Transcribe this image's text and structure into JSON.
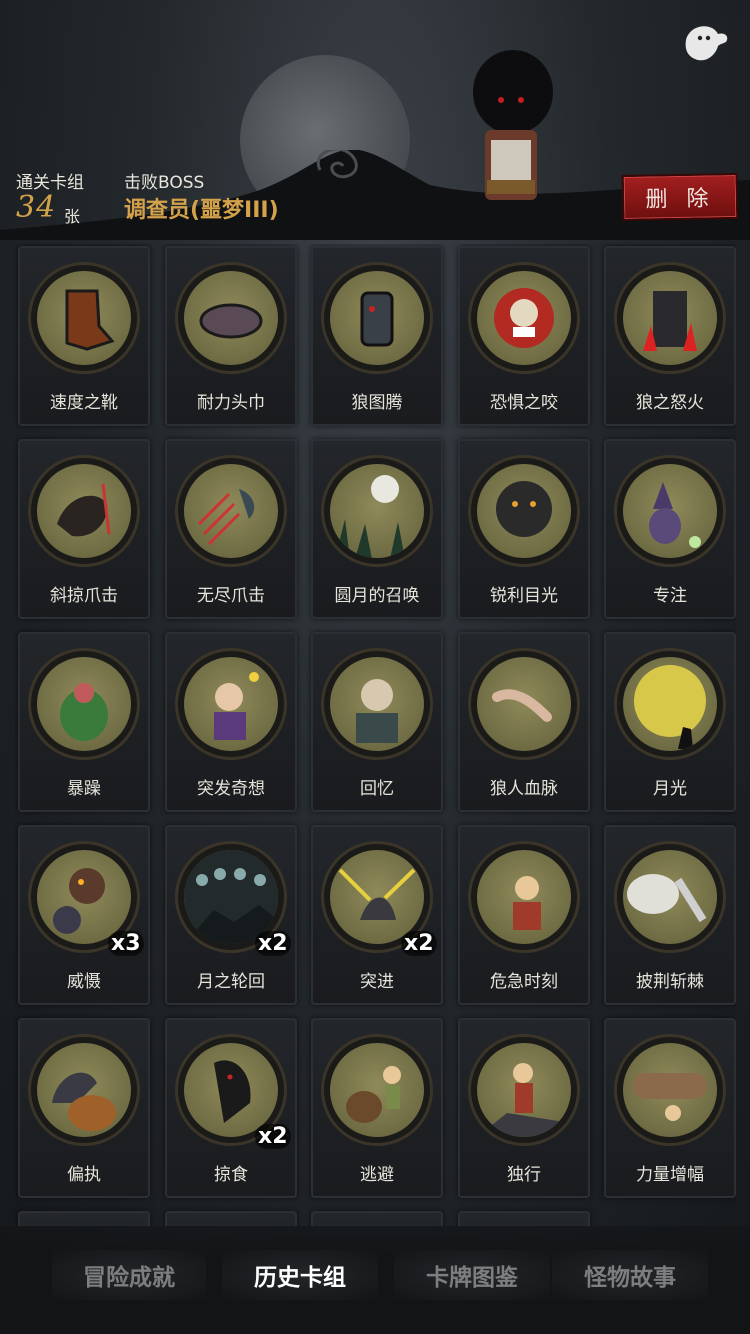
{
  "header": {
    "cleared_decks_label": "通关卡组",
    "cleared_decks_count": "34",
    "cleared_decks_unit": "张",
    "boss_label": "击败BOSS",
    "boss_name": "调查员(噩梦III)",
    "delete_label": "删 除",
    "ghost_icon": "ghost-icon"
  },
  "cards": [
    {
      "name": "速度之靴",
      "icon": "boot-icon"
    },
    {
      "name": "耐力头巾",
      "icon": "bandana-icon"
    },
    {
      "name": "狼图腾",
      "icon": "wolf-totem-icon"
    },
    {
      "name": "恐惧之咬",
      "icon": "fear-bite-icon"
    },
    {
      "name": "狼之怒火",
      "icon": "wolf-rage-icon"
    },
    {
      "name": "斜掠爪击",
      "icon": "slash-claw-icon"
    },
    {
      "name": "无尽爪击",
      "icon": "endless-claw-icon"
    },
    {
      "name": "圆月的召唤",
      "icon": "full-moon-call-icon"
    },
    {
      "name": "锐利目光",
      "icon": "sharp-gaze-icon"
    },
    {
      "name": "专注",
      "icon": "focus-icon"
    },
    {
      "name": "暴躁",
      "icon": "irritable-icon"
    },
    {
      "name": "突发奇想",
      "icon": "sudden-idea-icon"
    },
    {
      "name": "回忆",
      "icon": "memory-icon"
    },
    {
      "name": "狼人血脉",
      "icon": "werewolf-blood-icon"
    },
    {
      "name": "月光",
      "icon": "moonlight-icon"
    },
    {
      "name": "威慑",
      "icon": "intimidate-icon",
      "count": "x3"
    },
    {
      "name": "月之轮回",
      "icon": "moon-cycle-icon",
      "count": "x2"
    },
    {
      "name": "突进",
      "icon": "charge-icon",
      "count": "x2"
    },
    {
      "name": "危急时刻",
      "icon": "critical-moment-icon"
    },
    {
      "name": "披荆斩棘",
      "icon": "thorns-icon"
    },
    {
      "name": "偏执",
      "icon": "paranoia-icon"
    },
    {
      "name": "掠食",
      "icon": "predation-icon",
      "count": "x2"
    },
    {
      "name": "逃避",
      "icon": "escape-icon"
    },
    {
      "name": "独行",
      "icon": "lone-walk-icon"
    },
    {
      "name": "力量增幅",
      "icon": "power-boost-icon"
    }
  ],
  "tabs": [
    {
      "label": "冒险成就",
      "active": false
    },
    {
      "label": "历史卡组",
      "active": true
    },
    {
      "label": "卡牌图鉴",
      "active": false
    },
    {
      "label": "怪物故事",
      "active": false
    }
  ],
  "colors": {
    "accent_gold": "#d4a24a",
    "delete_red": "#a31f1f",
    "disc_olive": "#7a7548",
    "background": "#1e2226"
  }
}
